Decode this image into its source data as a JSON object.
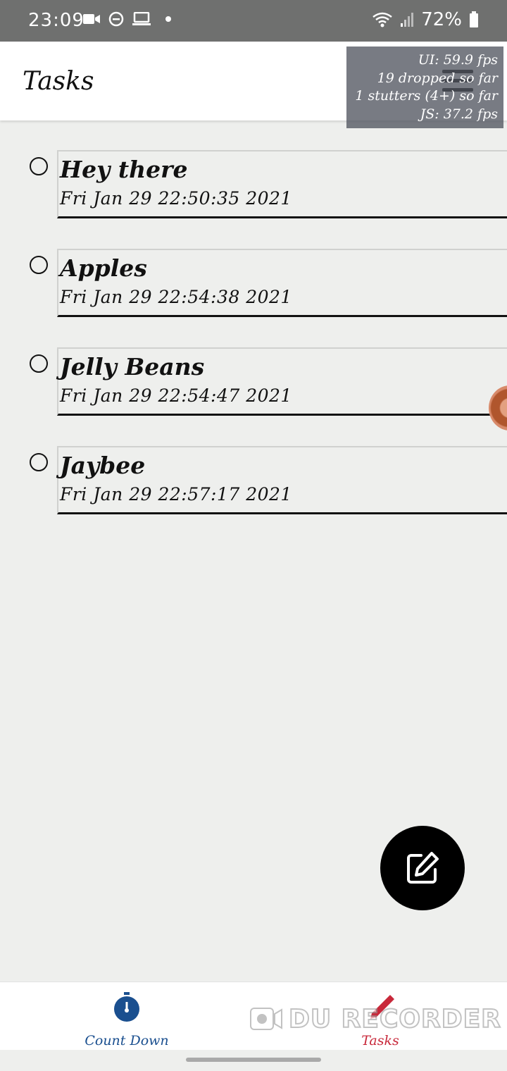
{
  "status_bar": {
    "time": "23:09",
    "battery": "72%"
  },
  "app_bar": {
    "title": "Tasks"
  },
  "perf_overlay": {
    "ui_fps": "UI: 59.9 fps",
    "dropped": "19 dropped so far",
    "stutters": "1 stutters (4+) so far",
    "js_fps": "JS: 37.2 fps"
  },
  "tasks": [
    {
      "title": "Hey there",
      "date": "Fri Jan 29 22:50:35 2021"
    },
    {
      "title": "Apples",
      "date": "Fri Jan 29 22:54:38 2021"
    },
    {
      "title": "Jelly Beans",
      "date": "Fri Jan 29 22:54:47 2021"
    },
    {
      "title": "Jaybee",
      "date": "Fri Jan 29 22:57:17 2021"
    }
  ],
  "bottom_nav": {
    "items": [
      {
        "label": "Count Down",
        "icon": "stopwatch-icon",
        "color": "#1a4f8f"
      },
      {
        "label": "Tasks",
        "icon": "pencil-icon",
        "color": "#c8283a"
      }
    ]
  },
  "watermark": "DU RECORDER",
  "colors": {
    "background": "#eeefed",
    "status_bar": "#6f706f",
    "fab": "#000000"
  }
}
